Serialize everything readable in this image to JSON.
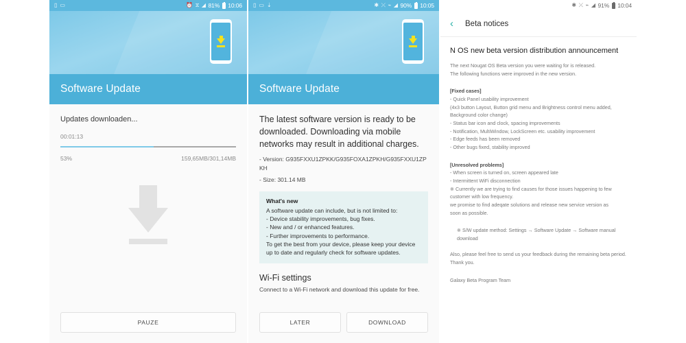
{
  "panel1": {
    "statusbar": {
      "left_icons": [
        "sim-card-icon",
        "sd-card-icon"
      ],
      "right_icons": [
        "alarm-icon",
        "no-sound-icon",
        "signal-icon"
      ],
      "battery": "81%",
      "time": "10:06"
    },
    "hero": {
      "title": "Software Update",
      "illustration": "phone-download-icon"
    },
    "download_status": "Updates downloaden...",
    "elapsed": "00:01:13",
    "progress_percent": "53%",
    "progress_value": 53,
    "size_progress": "159,65MB/301,14MB",
    "center_illustration": "large-download-arrow-icon",
    "buttons": [
      {
        "label": "PAUZE",
        "name": "pause-button"
      }
    ]
  },
  "panel2": {
    "statusbar": {
      "left_icons": [
        "sim-card-icon",
        "sd-card-icon",
        "download-icon"
      ],
      "right_icons": [
        "bluetooth-icon",
        "mute-icon",
        "wifi-icon",
        "signal-icon"
      ],
      "battery": "90%",
      "time": "10:05"
    },
    "hero": {
      "title": "Software Update",
      "illustration": "phone-download-icon"
    },
    "lead": "The latest software version is ready to be downloaded. Downloading via mobile networks may result in additional charges.",
    "version_line": "- Version: G935FXXU1ZPKK/G935FOXA1ZPKH/G935FXXU1ZPKH",
    "size_line": "- Size: 301.14 MB",
    "whats_new": {
      "title": "What's new",
      "body": "A software update can include, but is not limited to:\n - Device stability improvements, bug fixes.\n - New and / or enhanced features.\n - Further improvements to performance.\nTo get the best from your device, please keep your device up to date and regularly check for software updates."
    },
    "wifi": {
      "title": "Wi-Fi settings",
      "desc": "Connect to a Wi-Fi network and download this update for free."
    },
    "buttons": [
      {
        "label": "LATER",
        "name": "later-button"
      },
      {
        "label": "DOWNLOAD",
        "name": "download-button"
      }
    ]
  },
  "panel3": {
    "statusbar": {
      "right_icons": [
        "bluetooth-icon",
        "mute-icon",
        "wifi-icon",
        "signal-icon"
      ],
      "battery": "91%",
      "time": "10:04"
    },
    "appbar": {
      "back_icon": "back-chevron-icon",
      "title": "Beta notices"
    },
    "notice_title": "N OS new beta version distribution announcement",
    "intro": "The next Nougat OS Beta version you were waiting for is released.\nThe following functions were improved in the new version.",
    "fixed_heading": "[Fixed cases]",
    "fixed_body": "- Quick Panel usability improvement\n (4x3 button Layout, Button grid  menu and Brightness control menu added,\nBackground color change)\n- Status bar icon and clock, spacing improvements\n- Notification, MultiWindow, LockScreen etc. usability improvement\n- Edge feeds has been removed\n- Other bugs fixed, stability improved",
    "unresolved_heading": "[Unresolved problems]",
    "unresolved_body": "- When screen is turned on, screen appeared late\n- Intermittent WiFi disconnection\n※ Currently we are trying to find  causes for those issues happening to few\ncustomer with low frequency.\n   we promise to find adeqate  solutions and release new service version as\nsoon as possible.",
    "method_line": "※ S/W update method: Settings → Software Update → Software manual download",
    "feedback": "Also, please feel free to send us your feedback during the remaining beta period.\nThank you.",
    "signature": "Galaxy Beta Program Team"
  },
  "colors": {
    "hero_blue": "#4cb0d8",
    "status_blue": "#5cb8de",
    "accent_teal": "#27b0a6",
    "progress_blue": "#7ec9e8",
    "whats_new_bg": "#e6f2f2",
    "download_yellow": "#f5e11e"
  }
}
